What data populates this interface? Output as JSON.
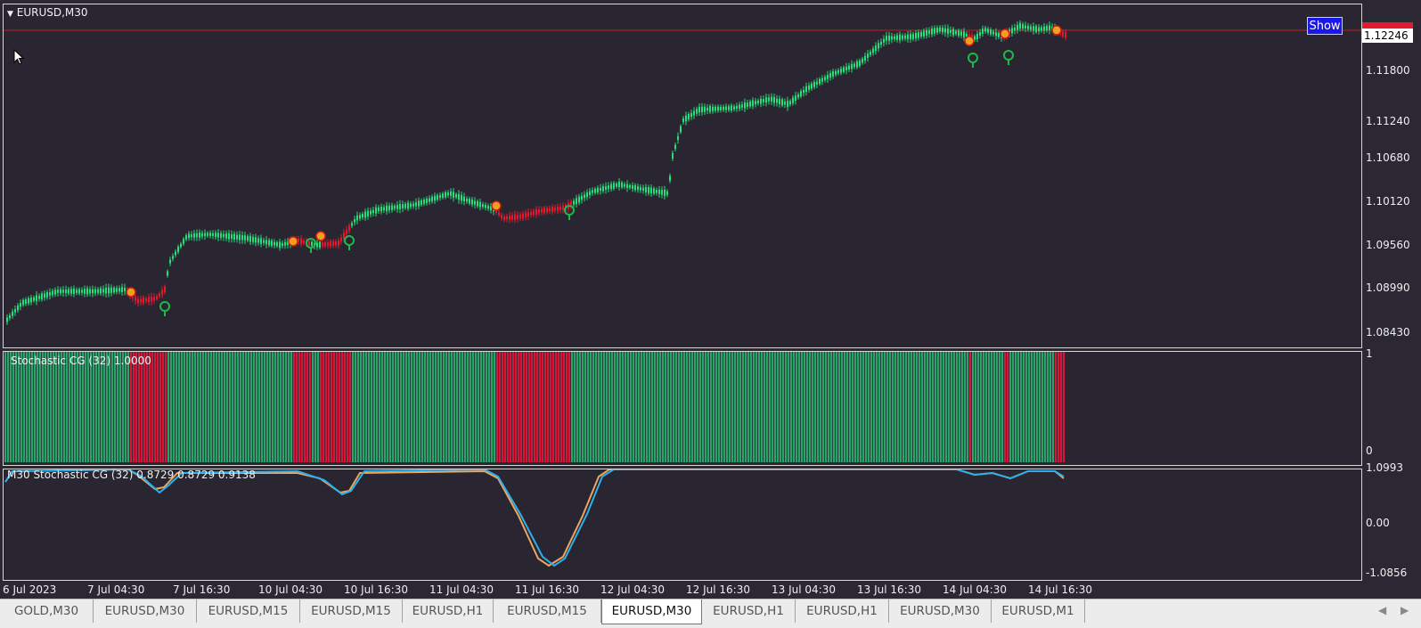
{
  "chart": {
    "symbol_label": "EURUSD,M30",
    "show_button": "Show",
    "current_price": "1.12246",
    "price_ticks": [
      "1.11800",
      "1.11240",
      "1.10680",
      "1.10120",
      "1.09560",
      "1.08990",
      "1.08430"
    ],
    "bull_color": "#22e07a",
    "bear_color": "#e4192d",
    "hline_color": "#c61b1b"
  },
  "histogram": {
    "label": "Stochastic CG (32) 1.0000",
    "scale_top": "1",
    "scale_bottom": "0",
    "green_color": "#2aa46a",
    "red_color": "#d4173a"
  },
  "oscillator": {
    "label": "M30 Stochastic CG (32) 0.8729 0.8729 0.9138",
    "scale": [
      "1.0993",
      "0.00",
      "-1.0856"
    ],
    "line1_color": "#2ab0ef",
    "line2_color": "#f0a65a"
  },
  "time_axis": [
    "6 Jul 2023",
    "7 Jul 04:30",
    "7 Jul 16:30",
    "10 Jul 04:30",
    "10 Jul 16:30",
    "11 Jul 04:30",
    "11 Jul 16:30",
    "12 Jul 04:30",
    "12 Jul 16:30",
    "13 Jul 04:30",
    "13 Jul 16:30",
    "14 Jul 04:30",
    "14 Jul 16:30"
  ],
  "tabs": [
    {
      "label": "GOLD,M30",
      "active": false
    },
    {
      "label": "EURUSD,M30",
      "active": false
    },
    {
      "label": "EURUSD,M15",
      "active": false
    },
    {
      "label": "EURUSD,M15",
      "active": false
    },
    {
      "label": "EURUSD,H1",
      "active": false
    },
    {
      "label": "EURUSD,M15",
      "active": false
    },
    {
      "label": "EURUSD,M30",
      "active": true
    },
    {
      "label": "EURUSD,H1",
      "active": false
    },
    {
      "label": "EURUSD,H1",
      "active": false
    },
    {
      "label": "EURUSD,M30",
      "active": false
    },
    {
      "label": "EURUSD,M1",
      "active": false
    }
  ],
  "tab_arrows": [
    "◀",
    "▶"
  ]
}
